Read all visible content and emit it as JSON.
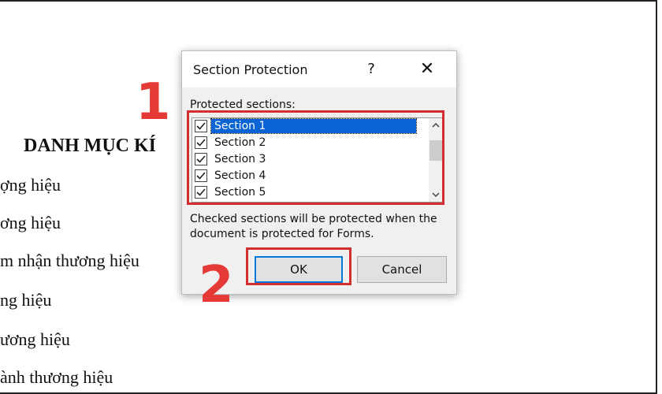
{
  "document": {
    "heading": "DANH MỤC KÍ",
    "lines": [
      "ợng hiệu",
      "ơng hiệu",
      "m nhận thương hiệu",
      "ng hiệu",
      "ương hiệu",
      "ành thương hiệu"
    ]
  },
  "dialog": {
    "title": "Section Protection",
    "help_glyph": "?",
    "close_glyph": "✕",
    "list_label": "Protected sections:",
    "sections": [
      {
        "label": "Section 1",
        "checked": true,
        "selected": true
      },
      {
        "label": "Section 2",
        "checked": true,
        "selected": false
      },
      {
        "label": "Section 3",
        "checked": true,
        "selected": false
      },
      {
        "label": "Section 4",
        "checked": true,
        "selected": false
      },
      {
        "label": "Section 5",
        "checked": true,
        "selected": false
      }
    ],
    "description": "Checked sections will be protected when the document is protected for Forms.",
    "ok_label": "OK",
    "cancel_label": "Cancel"
  },
  "annotations": {
    "step1": "1",
    "step2": "2",
    "highlight_color": "#d32f2f"
  },
  "colors": {
    "selection": "#0a64d4",
    "focus_border": "#0078d7"
  }
}
